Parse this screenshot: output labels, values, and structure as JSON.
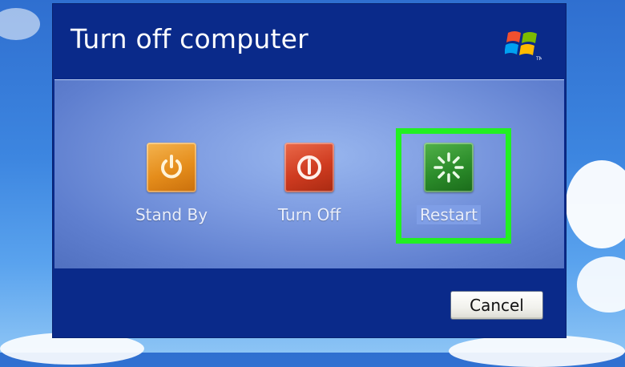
{
  "dialog": {
    "title": "Turn off computer",
    "logo_icon": "windows-logo-icon"
  },
  "options": [
    {
      "label": "Stand By",
      "icon": "power-icon",
      "color": "#e58d1b"
    },
    {
      "label": "Turn Off",
      "icon": "shutdown-icon",
      "color": "#cf3b20"
    },
    {
      "label": "Restart",
      "icon": "restart-icon",
      "color": "#2b8c2a",
      "highlighted": true
    }
  ],
  "footer": {
    "cancel_label": "Cancel"
  },
  "colors": {
    "dialog_bg": "#0a2a8a",
    "panel_bg": "#7c9ae0",
    "highlight": "#22f022"
  }
}
